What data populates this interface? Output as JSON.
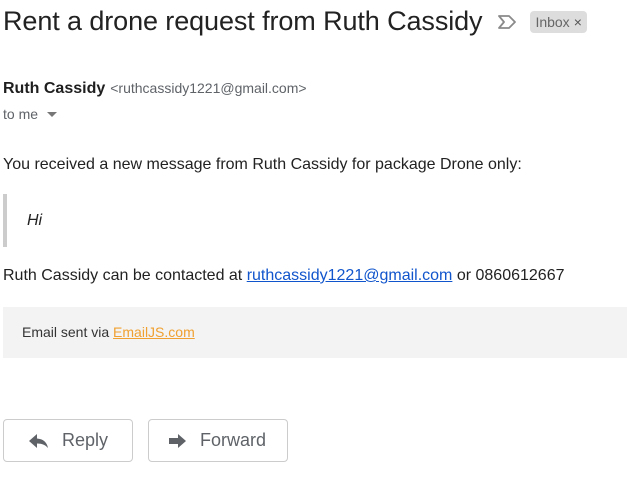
{
  "email": {
    "subject": "Rent a drone request from Ruth Cassidy",
    "label_chip": "Inbox",
    "label_chip_close": "×",
    "sender_name": "Ruth Cassidy",
    "sender_email": "<ruthcassidy1221@gmail.com>",
    "recipient": "to me",
    "intro": "You received a new message from Ruth Cassidy for package Drone only:",
    "quoted_message": "Hi",
    "contact_prefix": "Ruth Cassidy can be contacted at ",
    "contact_email": "ruthcassidy1221@gmail.com",
    "contact_middle": " or ",
    "contact_phone": "0860612667",
    "footer_prefix": "Email sent via ",
    "footer_link": "EmailJS.com"
  },
  "actions": {
    "reply_label": "Reply",
    "forward_label": "Forward"
  },
  "icons": {
    "label_arrow": "label-arrow-icon",
    "caret": "caret-down-icon",
    "reply": "reply-arrow-icon",
    "forward": "forward-arrow-icon"
  },
  "colors": {
    "link": "#1155cc",
    "footer_link": "#f0a030",
    "footer_bg": "#f3f3f3",
    "chip_bg": "#dddddd"
  }
}
